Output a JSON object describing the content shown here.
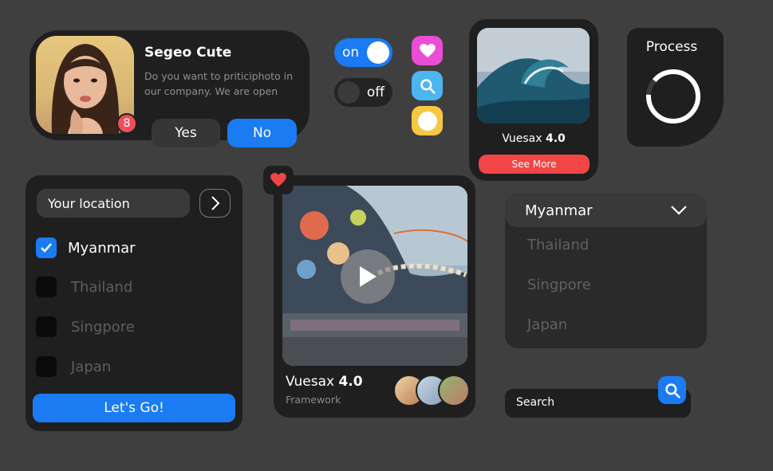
{
  "profile": {
    "name": "Segeo Cute",
    "message": "Do you want to priticiphoto in our company. We are open",
    "badge_count": "8",
    "yes_label": "Yes",
    "no_label": "No"
  },
  "toggles": {
    "on_label": "on",
    "off_label": "off"
  },
  "icon_buttons": [
    "heart-icon",
    "search-icon",
    "circle-icon"
  ],
  "wave_card": {
    "name_prefix": "Vuesax",
    "name_version": "4.0",
    "button_label": "See More"
  },
  "process": {
    "title": "Process"
  },
  "location": {
    "placeholder": "Your location",
    "options": [
      {
        "label": "Myanmar",
        "checked": true
      },
      {
        "label": "Thailand",
        "checked": false
      },
      {
        "label": "Singpore",
        "checked": false
      },
      {
        "label": "Japan",
        "checked": false
      }
    ],
    "submit_label": "Let's Go!"
  },
  "video_card": {
    "title_prefix": "Vuesax",
    "title_version": "4.0",
    "subtitle": "Framework"
  },
  "dropdown": {
    "selected": "Myanmar",
    "options": [
      "Thailand",
      "Singpore",
      "Japan"
    ]
  },
  "search": {
    "label": "Search"
  },
  "colors": {
    "background": "#403f40",
    "card": "#1f1f20",
    "primary": "#1a7bf2",
    "danger": "#f24545"
  }
}
